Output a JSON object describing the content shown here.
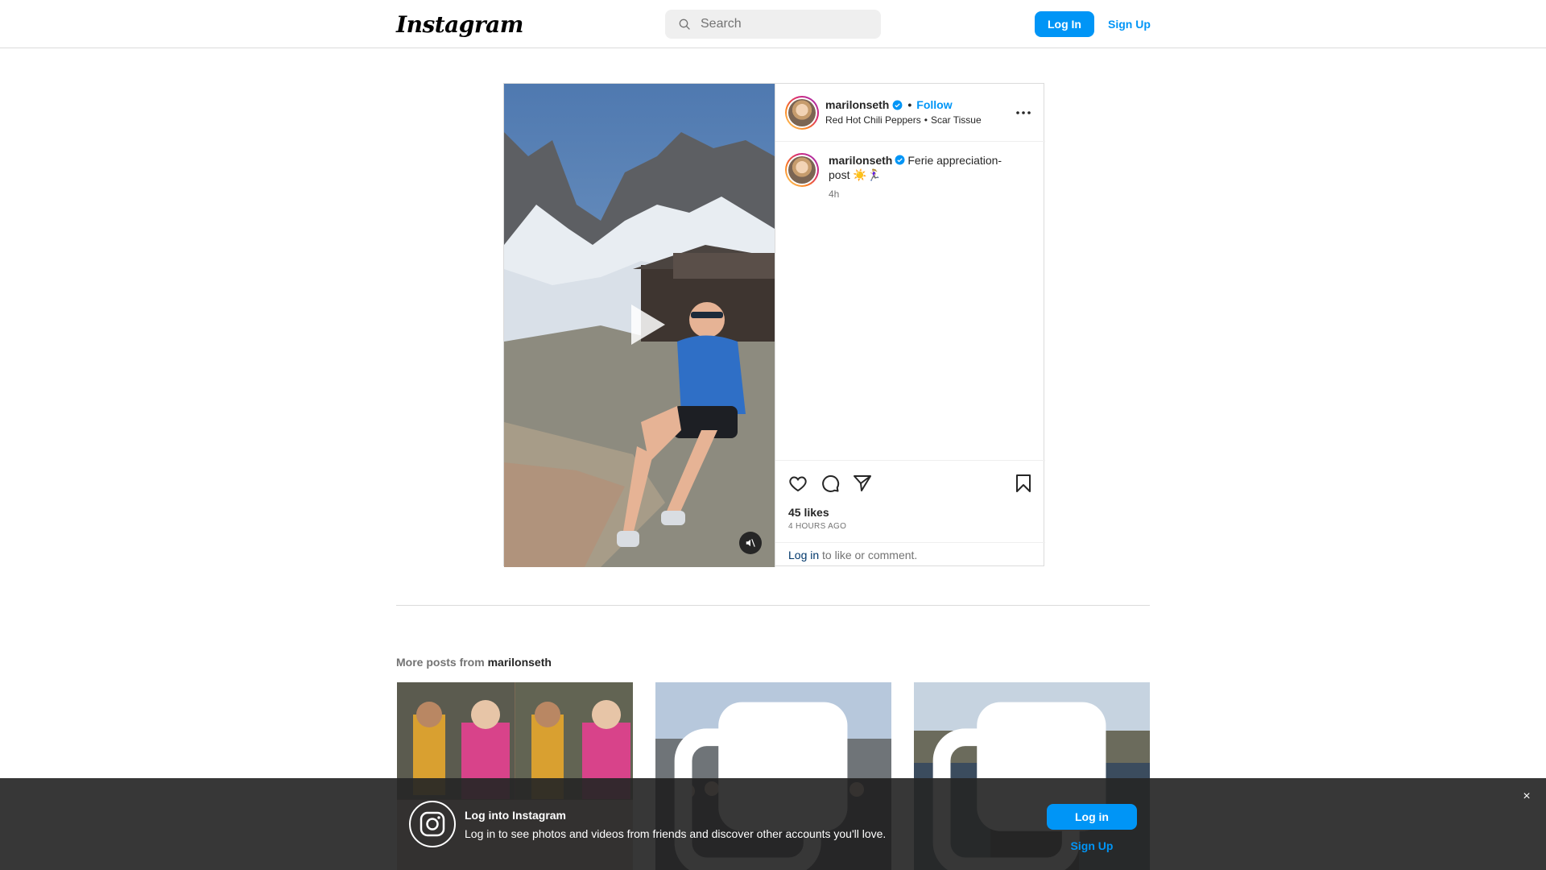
{
  "nav": {
    "logo": "Instagram",
    "search_placeholder": "Search",
    "login_label": "Log In",
    "signup_label": "Sign Up"
  },
  "post": {
    "username": "marilonseth",
    "follow_label": "Follow",
    "music_artist": "Red Hot Chili Peppers",
    "music_track": "Scar Tissue",
    "caption_user": "marilonseth",
    "caption_text": "Ferie appreciation-post ☀️🏃🏼‍♀️",
    "caption_time": "4h",
    "likes": "45 likes",
    "time_ago": "4 HOURS AGO",
    "login_link": "Log in",
    "login_rest": " to like or comment."
  },
  "more": {
    "prefix": "More posts from ",
    "username": "marilonseth"
  },
  "banner": {
    "title": "Log into Instagram",
    "text": "Log in to see photos and videos from friends and discover other accounts you'll love.",
    "login_label": "Log in",
    "signup_label": "Sign Up",
    "close": "×"
  },
  "colors": {
    "accent": "#0095f6",
    "border": "#dbdbdb",
    "banner_bg": "#262626"
  }
}
